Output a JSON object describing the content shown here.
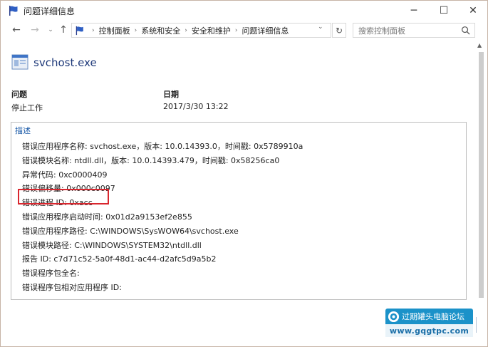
{
  "window": {
    "title": "问题详细信息",
    "controls": {
      "minimize": "─",
      "maximize": "☐",
      "close": "✕"
    }
  },
  "nav": {
    "back": "←",
    "forward": "→",
    "recent": "⌄",
    "up": "↑",
    "breadcrumbs": [
      "控制面板",
      "系统和安全",
      "安全和维护",
      "问题详细信息"
    ],
    "separator": "›",
    "dropdown": "⌄",
    "refresh": "↻",
    "search_placeholder": "搜索控制面板"
  },
  "app": {
    "name": "svchost.exe"
  },
  "problem": {
    "label": "问题",
    "value": "停止工作"
  },
  "date": {
    "label": "日期",
    "value": "2017/3/30 13:22"
  },
  "description": {
    "title": "描述",
    "rows": [
      "错误应用程序名称: svchost.exe，版本: 10.0.14393.0，时间戳: 0x5789910a",
      "错误模块名称: ntdll.dll，版本: 10.0.14393.479，时间戳: 0x58256ca0",
      "异常代码: 0xc0000409",
      "错误偏移量: 0x000c0097",
      "错误进程 ID: 0xacc",
      "错误应用程序启动时间: 0x01d2a9153ef2e855",
      "错误应用程序路径: C:\\WINDOWS\\SysWOW64\\svchost.exe",
      "错误模块路径: C:\\WINDOWS\\SYSTEM32\\ntdll.dll",
      "报告 ID: c7d71c52-5a0f-48d1-ac44-d2afc5d9a5b2",
      "错误程序包全名:",
      "错误程序包相对应用程序 ID:"
    ]
  },
  "watermark": {
    "line1": "过期罐头电脑论坛",
    "line2": "www.gqgtpc.com"
  },
  "colors": {
    "accent": "#1a5aa8",
    "app_name": "#1f3a7a",
    "highlight": "#d9262e",
    "watermark": "#1b92c9"
  }
}
